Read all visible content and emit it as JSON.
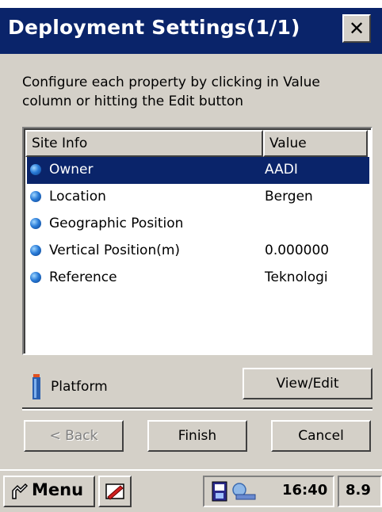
{
  "dialog": {
    "title": "Deployment Settings(1/1)",
    "close_label": "✕",
    "instructions": "Configure each property by clicking in Value column or hitting the Edit button"
  },
  "list": {
    "columns": [
      "Site Info",
      "Value"
    ],
    "rows": [
      {
        "property": "Owner",
        "value": "AADI",
        "selected": true
      },
      {
        "property": "Location",
        "value": "Bergen",
        "selected": false
      },
      {
        "property": "Geographic Position",
        "value": "",
        "selected": false
      },
      {
        "property": "Vertical Position(m)",
        "value": "0.000000",
        "selected": false
      },
      {
        "property": "Reference",
        "value": "Teknologi",
        "selected": false
      }
    ]
  },
  "platform": {
    "label": "Platform",
    "icon": "platform-instrument-icon",
    "view_edit_label": "View/Edit"
  },
  "buttons": {
    "back": "< Back",
    "finish": "Finish",
    "cancel": "Cancel"
  },
  "taskbar": {
    "menu_label": "Menu",
    "time": "16:40",
    "version": "8.9"
  },
  "colors": {
    "title_bar": "#0a246a",
    "selection": "#0a246a",
    "face": "#d4d0c8"
  }
}
